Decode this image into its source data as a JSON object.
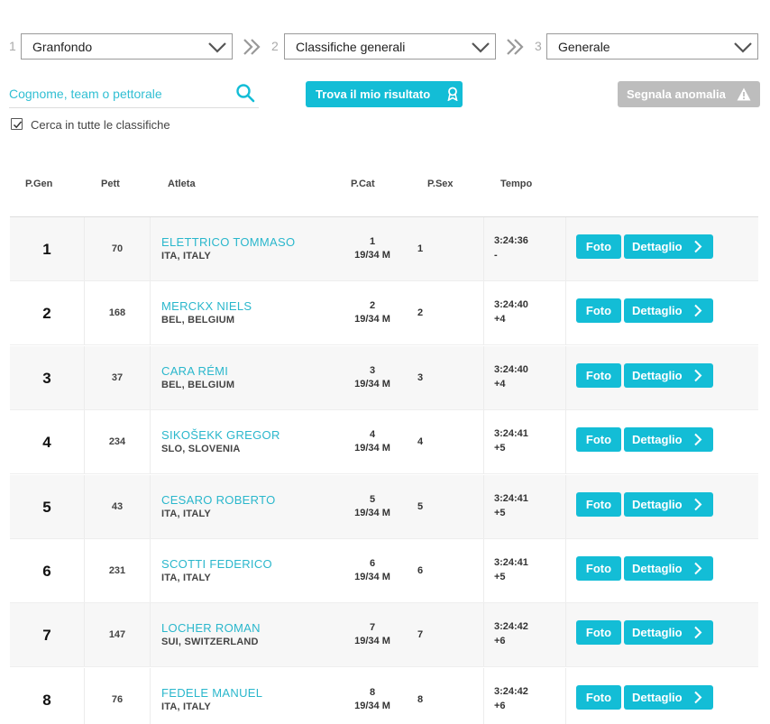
{
  "filters": {
    "step1": {
      "num": "1",
      "value": "Granfondo"
    },
    "step2": {
      "num": "2",
      "value": "Classifiche generali"
    },
    "step3": {
      "num": "3",
      "value": "Generale"
    }
  },
  "search": {
    "placeholder": "Cognome, team o pettorale",
    "find_label": "Trova il mio risultato",
    "report_label": "Segnala anomalia",
    "all_rankings_label": "Cerca in tutte le classifiche",
    "all_rankings_checked": true
  },
  "table": {
    "headers": {
      "pgen": "P.Gen",
      "pett": "Pett",
      "atleta": "Atleta",
      "pcat": "P.Cat",
      "psex": "P.Sex",
      "tempo": "Tempo"
    },
    "foto_label": "Foto",
    "detail_label": "Dettaglio",
    "rows": [
      {
        "pos": "1",
        "bib": "70",
        "name": "ELETTRICO TOMMASO",
        "nat": "ITA, ITALY",
        "pcat": "1",
        "cat": "19/34 M",
        "psex": "1",
        "time": "3:24:36",
        "gap": "-"
      },
      {
        "pos": "2",
        "bib": "168",
        "name": "MERCKX NIELS",
        "nat": "BEL, BELGIUM",
        "pcat": "2",
        "cat": "19/34 M",
        "psex": "2",
        "time": "3:24:40",
        "gap": "+4"
      },
      {
        "pos": "3",
        "bib": "37",
        "name": "CARA RÉMI",
        "nat": "BEL, BELGIUM",
        "pcat": "3",
        "cat": "19/34 M",
        "psex": "3",
        "time": "3:24:40",
        "gap": "+4"
      },
      {
        "pos": "4",
        "bib": "234",
        "name": "SIKOŠEKK GREGOR",
        "nat": "SLO, SLOVENIA",
        "pcat": "4",
        "cat": "19/34 M",
        "psex": "4",
        "time": "3:24:41",
        "gap": "+5"
      },
      {
        "pos": "5",
        "bib": "43",
        "name": "CESARO ROBERTO",
        "nat": "ITA, ITALY",
        "pcat": "5",
        "cat": "19/34 M",
        "psex": "5",
        "time": "3:24:41",
        "gap": "+5"
      },
      {
        "pos": "6",
        "bib": "231",
        "name": "SCOTTI FEDERICO",
        "nat": "ITA, ITALY",
        "pcat": "6",
        "cat": "19/34 M",
        "psex": "6",
        "time": "3:24:41",
        "gap": "+5"
      },
      {
        "pos": "7",
        "bib": "147",
        "name": "LOCHER ROMAN",
        "nat": "SUI, SWITZERLAND",
        "pcat": "7",
        "cat": "19/34 M",
        "psex": "7",
        "time": "3:24:42",
        "gap": "+6"
      },
      {
        "pos": "8",
        "bib": "76",
        "name": "FEDELE MANUEL",
        "nat": "ITA, ITALY",
        "pcat": "8",
        "cat": "19/34 M",
        "psex": "8",
        "time": "3:24:42",
        "gap": "+6"
      }
    ]
  },
  "colors": {
    "accent": "#13bdd6",
    "link": "#2ab7cc",
    "disabled": "#bdbdbd"
  }
}
